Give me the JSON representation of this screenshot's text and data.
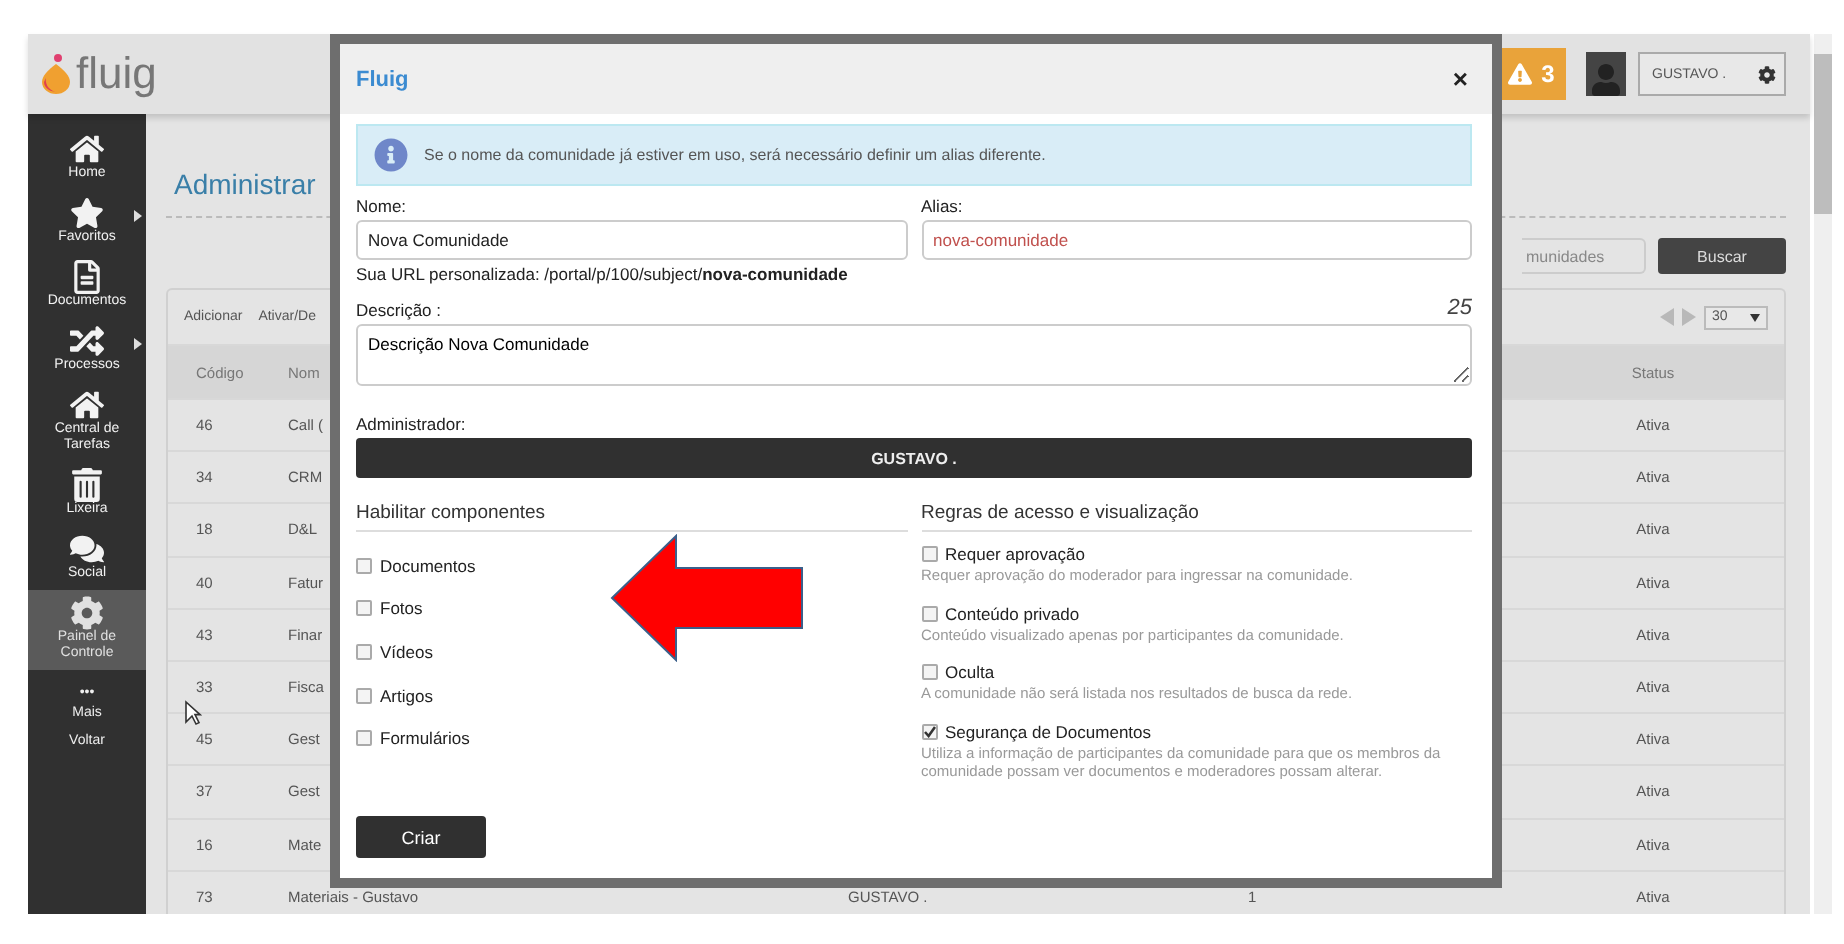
{
  "app": {
    "logo": "fluig",
    "alerts": "3",
    "user": "GUSTAVO ."
  },
  "sidebar": [
    {
      "label": "Home",
      "selected": false,
      "submenu": false
    },
    {
      "label": "Favoritos",
      "selected": false,
      "submenu": true
    },
    {
      "label": "Documentos",
      "selected": false,
      "submenu": false
    },
    {
      "label": "Processos",
      "selected": false,
      "submenu": true
    },
    {
      "label": "Central de Tarefas",
      "selected": false,
      "submenu": false
    },
    {
      "label": "Lixeira",
      "selected": false,
      "submenu": false
    },
    {
      "label": "Social",
      "selected": false,
      "submenu": false
    },
    {
      "label": "Painel de Controle",
      "selected": true,
      "submenu": false
    }
  ],
  "sidebar_more": {
    "dots": "•••",
    "more": "Mais",
    "back": "Voltar"
  },
  "page": {
    "title": "Administrar",
    "search_placeholder": "munidades",
    "search_button": "Buscar"
  },
  "table": {
    "actions": [
      "Adicionar",
      "Ativar/De"
    ],
    "page_size": "30",
    "columns": [
      "Código",
      "Nom",
      "Status"
    ],
    "rows": [
      {
        "code": "46",
        "name": "Call (",
        "owner": "",
        "count": "",
        "status": "Ativa"
      },
      {
        "code": "34",
        "name": "CRM",
        "owner": "",
        "count": "",
        "status": "Ativa"
      },
      {
        "code": "18",
        "name": "D&L",
        "owner": "",
        "count": "",
        "status": "Ativa"
      },
      {
        "code": "40",
        "name": "Fatur",
        "owner": "",
        "count": "",
        "status": "Ativa"
      },
      {
        "code": "43",
        "name": "Finar",
        "owner": "",
        "count": "",
        "status": "Ativa"
      },
      {
        "code": "33",
        "name": "Fisca",
        "owner": "",
        "count": "",
        "status": "Ativa"
      },
      {
        "code": "45",
        "name": "Gest",
        "owner": "",
        "count": "",
        "status": "Ativa"
      },
      {
        "code": "37",
        "name": "Gest",
        "owner": "",
        "count": "",
        "status": "Ativa"
      },
      {
        "code": "16",
        "name": "Mate",
        "owner": "",
        "count": "",
        "status": "Ativa"
      },
      {
        "code": "73",
        "name": "Materiais - Gustavo",
        "owner": "GUSTAVO .",
        "count": "1",
        "status": "Ativa"
      }
    ]
  },
  "dialog": {
    "title": "Fluig",
    "close": "×",
    "info": "Se o nome da comunidade já estiver em uso, será necessário definir um alias diferente.",
    "name_label": "Nome:",
    "name_value": "Nova Comunidade",
    "alias_label": "Alias:",
    "alias_value": "nova-comunidade",
    "url": "Sua URL personalizada: /portal/p/100/subject/**nova-comunidade**",
    "description_label": "Descrição :",
    "description_count": "25",
    "description_value": "Descrição Nova Comunidade",
    "admin_label": "Administrador:",
    "admin_value": "GUSTAVO .",
    "components_heading": "Habilitar componentes",
    "components": [
      {
        "label": "Documentos",
        "checked": false
      },
      {
        "label": "Fotos",
        "checked": false
      },
      {
        "label": "Vídeos",
        "checked": false
      },
      {
        "label": "Artigos",
        "checked": false
      },
      {
        "label": "Formulários",
        "checked": false
      }
    ],
    "rules_heading": "Regras de acesso e visualização",
    "rules": [
      {
        "label": "Requer aprovação",
        "hint": "Requer aprovação do moderador para ingressar na comunidade.",
        "checked": false
      },
      {
        "label": "Conteúdo privado",
        "hint": "Conteúdo visualizado apenas por participantes da comunidade.",
        "checked": false
      },
      {
        "label": "Oculta",
        "hint": "A comunidade não será listada nos resultados de busca da rede.",
        "checked": false
      },
      {
        "label": "Segurança de Documentos",
        "hint": "Utiliza a informação de participantes da comunidade para que os membros da comunidade possam ver documentos e moderadores possam alterar.",
        "checked": true
      }
    ],
    "submit": "Criar"
  }
}
